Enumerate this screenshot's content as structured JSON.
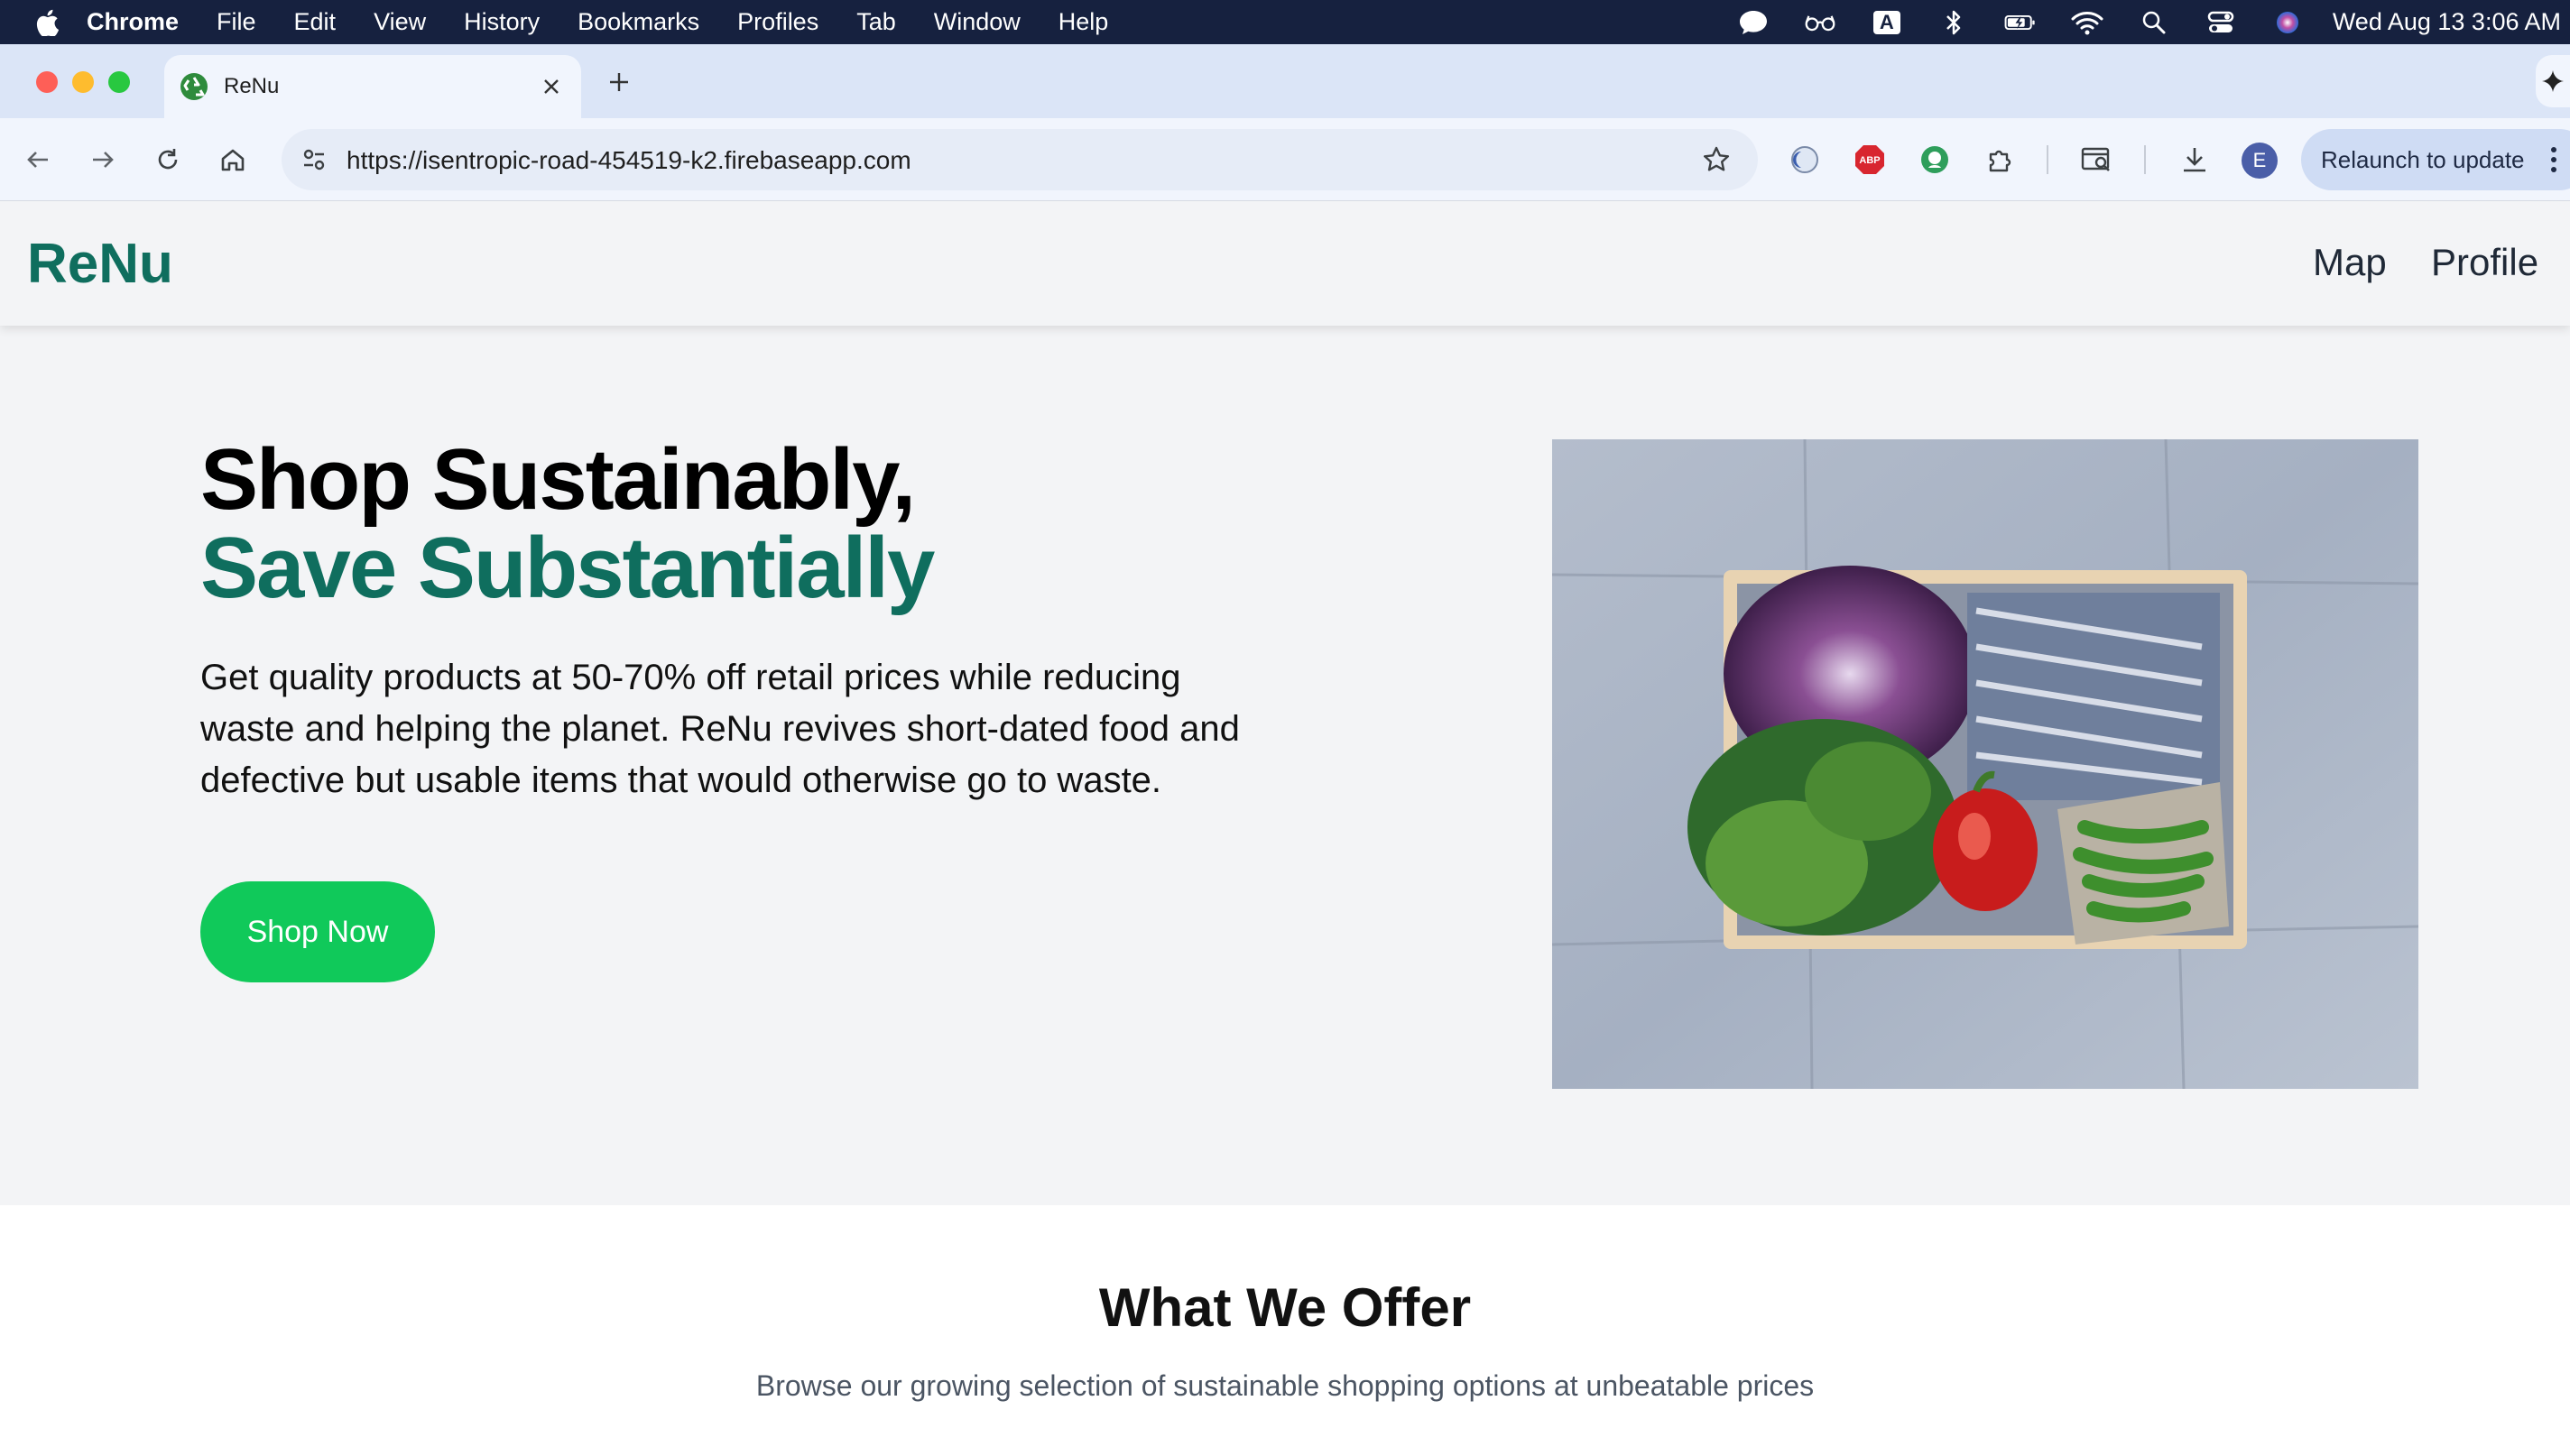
{
  "menubar": {
    "app": "Chrome",
    "items": [
      "File",
      "Edit",
      "View",
      "History",
      "Bookmarks",
      "Profiles",
      "Tab",
      "Window",
      "Help"
    ],
    "clock": "Wed Aug 13  3:06 AM",
    "status_icons": [
      "chat-bubble-icon",
      "glasses-icon",
      "input-source-icon",
      "bluetooth-icon",
      "battery-icon",
      "wifi-icon",
      "spotlight-icon",
      "control-center-icon",
      "siri-icon"
    ],
    "input_source": "A"
  },
  "browser": {
    "tab_title": "ReNu",
    "url": "https://isentropic-road-454519-k2.firebaseapp.com",
    "profile_initial": "E",
    "relaunch_label": "Relaunch to update",
    "extensions": [
      "privacy-extension-icon",
      "adblock-icon",
      "grammar-extension-icon",
      "puzzle-extensions-icon"
    ],
    "abp_text": "ABP"
  },
  "site": {
    "logo": "ReNu",
    "nav": {
      "map": "Map",
      "profile": "Profile"
    },
    "hero": {
      "title_line1": "Shop Sustainably,",
      "title_line2": "Save Substantially",
      "description": "Get quality products at 50-70% off retail prices while reducing waste and helping the planet. ReNu revives short-dated food and defective but usable items that would otherwise go to waste.",
      "cta": "Shop Now"
    },
    "offer": {
      "title": "What We Offer",
      "subtitle": "Browse our growing selection of sustainable shopping options at unbeatable prices"
    }
  },
  "colors": {
    "brand_green": "#0f6e5e",
    "cta_green": "#10c95a",
    "menubar_bg": "#16213f",
    "page_bg": "#f3f4f6"
  }
}
